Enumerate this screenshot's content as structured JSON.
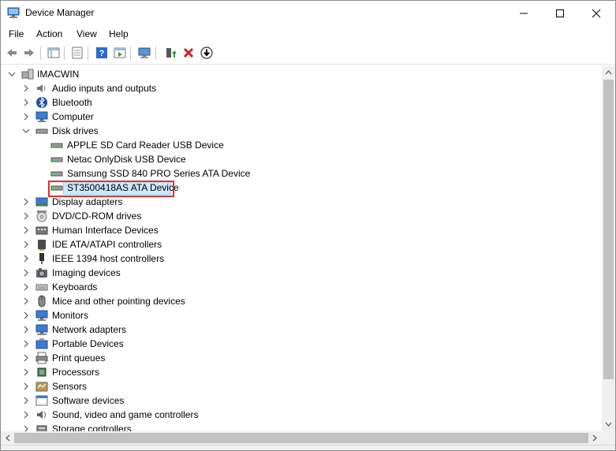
{
  "window": {
    "title": "Device Manager"
  },
  "menu": {
    "file": "File",
    "action": "Action",
    "view": "View",
    "help": "Help"
  },
  "toolbar": {
    "buttons": [
      "back-icon",
      "forward-icon",
      "show-hide-tree-icon",
      "properties-icon",
      "help-icon",
      "run-icon",
      "scan-hardware-icon",
      "update-driver-icon",
      "uninstall-icon",
      "disable-icon"
    ]
  },
  "tree": {
    "root": "IMACWIN",
    "disk_drives_children": [
      "APPLE SD Card Reader USB Device",
      "Netac OnlyDisk USB Device",
      "Samsung SSD 840 PRO Series ATA Device",
      "ST3500418AS ATA Device"
    ],
    "categories": [
      "Audio inputs and outputs",
      "Bluetooth",
      "Computer",
      "Disk drives",
      "Display adapters",
      "DVD/CD-ROM drives",
      "Human Interface Devices",
      "IDE ATA/ATAPI controllers",
      "IEEE 1394 host controllers",
      "Imaging devices",
      "Keyboards",
      "Mice and other pointing devices",
      "Monitors",
      "Network adapters",
      "Portable Devices",
      "Print queues",
      "Processors",
      "Sensors",
      "Software devices",
      "Sound, video and game controllers",
      "Storage controllers"
    ],
    "selected": "ST3500418AS ATA Device"
  },
  "colors": {
    "selection_bg": "#cce8ff",
    "highlight_border": "#d9312b"
  }
}
